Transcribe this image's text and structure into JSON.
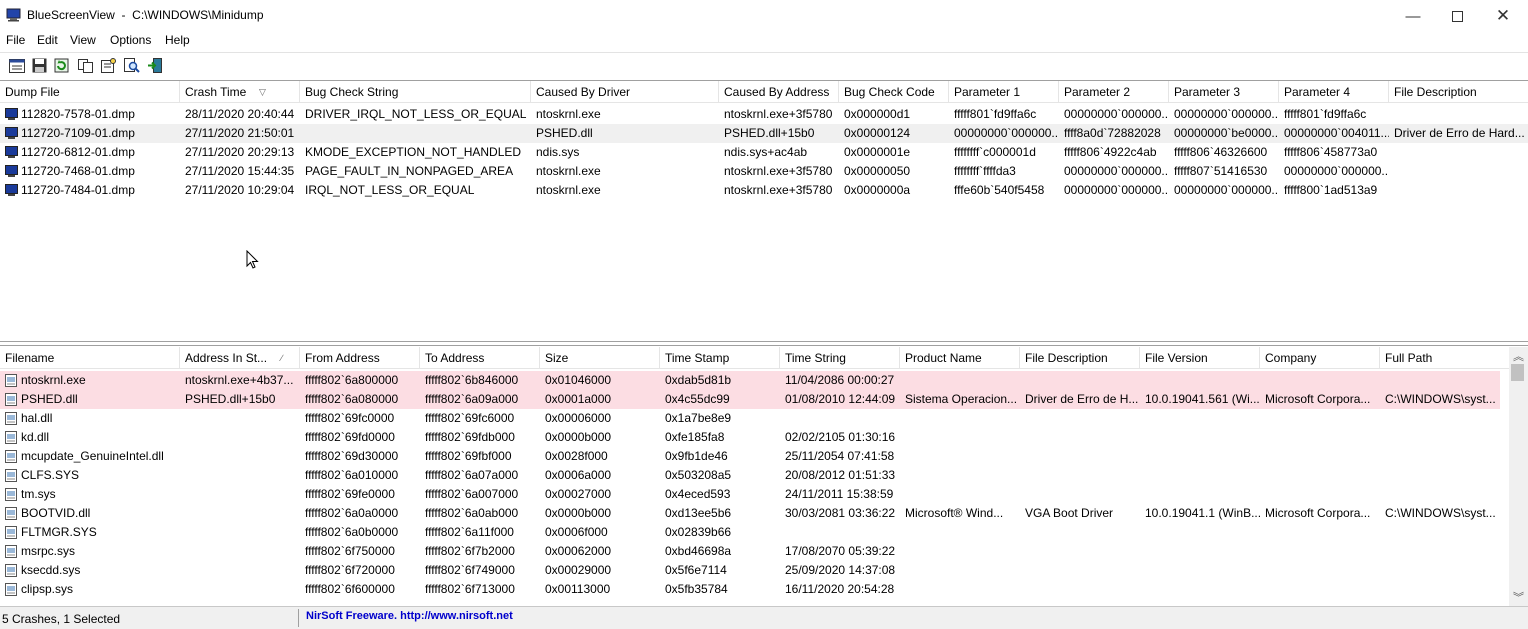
{
  "window": {
    "title": "BlueScreenView  -  C:\\WINDOWS\\Minidump",
    "icons": [
      "app-bluescreen-icon",
      "minimize-icon",
      "maximize-icon",
      "close-icon"
    ]
  },
  "menu": [
    "File",
    "Edit",
    "View",
    "Options",
    "Help"
  ],
  "toolbar": {
    "icons": [
      "html-report-icon",
      "save-icon",
      "refresh-icon",
      "copy-icon",
      "properties-icon",
      "find-icon",
      "exit-icon"
    ]
  },
  "crashes": {
    "columns": [
      "Dump File",
      "Crash Time",
      "Bug Check String",
      "Caused By Driver",
      "Caused By Address",
      "Bug Check Code",
      "Parameter 1",
      "Parameter 2",
      "Parameter 3",
      "Parameter 4",
      "File Description"
    ],
    "rows": [
      [
        "112820-7578-01.dmp",
        "28/11/2020 20:40:44",
        "DRIVER_IRQL_NOT_LESS_OR_EQUAL",
        "ntoskrnl.exe",
        "ntoskrnl.exe+3f5780",
        "0x000000d1",
        "fffff801`fd9ffa6c",
        "00000000`000000...",
        "00000000`000000...",
        "fffff801`fd9ffa6c",
        ""
      ],
      [
        "112720-7109-01.dmp",
        "27/11/2020 21:50:01",
        "",
        "PSHED.dll",
        "PSHED.dll+15b0",
        "0x00000124",
        "00000000`000000...",
        "ffff8a0d`72882028",
        "00000000`be0000...",
        "00000000`004011...",
        "Driver de Erro de Hard..."
      ],
      [
        "112720-6812-01.dmp",
        "27/11/2020 20:29:13",
        "KMODE_EXCEPTION_NOT_HANDLED",
        "ndis.sys",
        "ndis.sys+ac4ab",
        "0x0000001e",
        "ffffffff`c000001d",
        "fffff806`4922c4ab",
        "fffff806`46326600",
        "fffff806`458773a0",
        ""
      ],
      [
        "112720-7468-01.dmp",
        "27/11/2020 15:44:35",
        "PAGE_FAULT_IN_NONPAGED_AREA",
        "ntoskrnl.exe",
        "ntoskrnl.exe+3f5780",
        "0x00000050",
        "ffffffff`ffffda3",
        "00000000`000000...",
        "fffff807`51416530",
        "00000000`000000...",
        ""
      ],
      [
        "112720-7484-01.dmp",
        "27/11/2020 10:29:04",
        "IRQL_NOT_LESS_OR_EQUAL",
        "ntoskrnl.exe",
        "ntoskrnl.exe+3f5780",
        "0x0000000a",
        "fffe60b`540f5458",
        "00000000`000000...",
        "00000000`000000...",
        "fffff800`1ad513a9",
        ""
      ]
    ]
  },
  "drivers": {
    "columns": [
      "Filename",
      "Address In St...",
      "From Address",
      "To Address",
      "Size",
      "Time Stamp",
      "Time String",
      "Product Name",
      "File Description",
      "File Version",
      "Company",
      "Full Path"
    ],
    "rows": [
      [
        "ntoskrnl.exe",
        "ntoskrnl.exe+4b37...",
        "fffff802`6a800000",
        "fffff802`6b846000",
        "0x01046000",
        "0xdab5d81b",
        "11/04/2086 00:00:27",
        "",
        "",
        "",
        "",
        ""
      ],
      [
        "PSHED.dll",
        "PSHED.dll+15b0",
        "fffff802`6a080000",
        "fffff802`6a09a000",
        "0x0001a000",
        "0x4c55dc99",
        "01/08/2010 12:44:09",
        "Sistema Operacion...",
        "Driver de Erro de H...",
        "10.0.19041.561 (Wi...",
        "Microsoft Corpora...",
        "C:\\WINDOWS\\syst..."
      ],
      [
        "hal.dll",
        "",
        "fffff802`69fc0000",
        "fffff802`69fc6000",
        "0x00006000",
        "0x1a7be8e9",
        "",
        "",
        "",
        "",
        "",
        ""
      ],
      [
        "kd.dll",
        "",
        "fffff802`69fd0000",
        "fffff802`69fdb000",
        "0x0000b000",
        "0xfe185fa8",
        "02/02/2105 01:30:16",
        "",
        "",
        "",
        "",
        ""
      ],
      [
        "mcupdate_GenuineIntel.dll",
        "",
        "fffff802`69d30000",
        "fffff802`69fbf000",
        "0x0028f000",
        "0x9fb1de46",
        "25/11/2054 07:41:58",
        "",
        "",
        "",
        "",
        ""
      ],
      [
        "CLFS.SYS",
        "",
        "fffff802`6a010000",
        "fffff802`6a07a000",
        "0x0006a000",
        "0x503208a5",
        "20/08/2012 01:51:33",
        "",
        "",
        "",
        "",
        ""
      ],
      [
        "tm.sys",
        "",
        "fffff802`69fe0000",
        "fffff802`6a007000",
        "0x00027000",
        "0x4eced593",
        "24/11/2011 15:38:59",
        "",
        "",
        "",
        "",
        ""
      ],
      [
        "BOOTVID.dll",
        "",
        "fffff802`6a0a0000",
        "fffff802`6a0ab000",
        "0x0000b000",
        "0xd13ee5b6",
        "30/03/2081 03:36:22",
        "Microsoft® Wind...",
        "VGA Boot Driver",
        "10.0.19041.1 (WinB...",
        "Microsoft Corpora...",
        "C:\\WINDOWS\\syst..."
      ],
      [
        "FLTMGR.SYS",
        "",
        "fffff802`6a0b0000",
        "fffff802`6a11f000",
        "0x0006f000",
        "0x02839b66",
        "",
        "",
        "",
        "",
        "",
        ""
      ],
      [
        "msrpc.sys",
        "",
        "fffff802`6f750000",
        "fffff802`6f7b2000",
        "0x00062000",
        "0xbd46698a",
        "17/08/2070 05:39:22",
        "",
        "",
        "",
        "",
        ""
      ],
      [
        "ksecdd.sys",
        "",
        "fffff802`6f720000",
        "fffff802`6f749000",
        "0x00029000",
        "0x5f6e7114",
        "25/09/2020 14:37:08",
        "",
        "",
        "",
        "",
        ""
      ],
      [
        "clipsp.sys",
        "",
        "fffff802`6f600000",
        "fffff802`6f713000",
        "0x00113000",
        "0x5fb35784",
        "16/11/2020 20:54:28",
        "",
        "",
        "",
        "",
        ""
      ]
    ]
  },
  "status": {
    "summary": "5 Crashes, 1 Selected",
    "link": "NirSoft Freeware.  http://www.nirsoft.net"
  },
  "colors": {
    "pink_row": "#fcdde3",
    "selected_row": "#f0f0f0",
    "link": "#0000cc"
  }
}
